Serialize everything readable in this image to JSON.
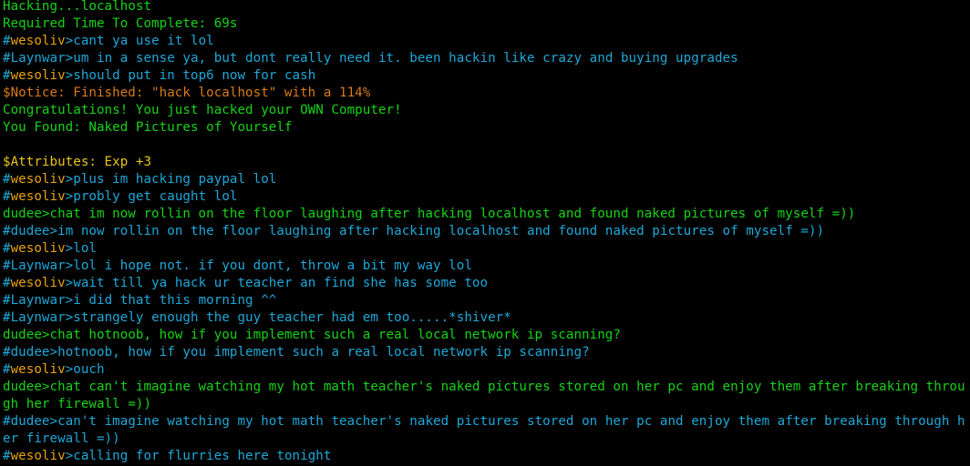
{
  "colors": {
    "system": "#17d317",
    "chat": "#1ea8d8",
    "notice": "#d97a1a",
    "attributes": "#e8c41a",
    "highlight_name": "#e8a30f",
    "background": "#000000"
  },
  "lines": [
    {
      "type": "system",
      "text": "Hacking...localhost"
    },
    {
      "type": "system",
      "text": "Required Time To Complete: 69s"
    },
    {
      "type": "chat",
      "prefix": "#",
      "user": "wesoliv",
      "highlight": true,
      "message": "cant ya use it lol"
    },
    {
      "type": "chat",
      "prefix": "#",
      "user": "Laynwar",
      "highlight": false,
      "message": "um in a sense ya, but dont really need it. been hackin like crazy and buying upgrades"
    },
    {
      "type": "chat",
      "prefix": "#",
      "user": "wesoliv",
      "highlight": true,
      "message": "should put in top6 now for cash"
    },
    {
      "type": "notice",
      "text": "$Notice: Finished: \"hack localhost\" with a 114%"
    },
    {
      "type": "system",
      "text": "Congratulations! You just hacked your OWN Computer!"
    },
    {
      "type": "system",
      "text": "You Found: Naked Pictures of Yourself"
    },
    {
      "type": "blank",
      "text": ""
    },
    {
      "type": "attributes",
      "text": "$Attributes: Exp +3"
    },
    {
      "type": "chat",
      "prefix": "#",
      "user": "wesoliv",
      "highlight": true,
      "message": "plus im hacking paypal lol"
    },
    {
      "type": "chat",
      "prefix": "#",
      "user": "wesoliv",
      "highlight": true,
      "message": "probly get caught lol"
    },
    {
      "type": "system",
      "text": "dudee>chat im now rollin on the floor laughing after hacking localhost and found naked pictures of myself =))"
    },
    {
      "type": "chat",
      "prefix": "#",
      "user": "dudee",
      "highlight": false,
      "message": "im now rollin on the floor laughing after hacking localhost and found naked pictures of myself =))"
    },
    {
      "type": "chat",
      "prefix": "#",
      "user": "wesoliv",
      "highlight": true,
      "message": "lol"
    },
    {
      "type": "chat",
      "prefix": "#",
      "user": "Laynwar",
      "highlight": false,
      "message": "lol i hope not. if you dont, throw a bit my way lol"
    },
    {
      "type": "chat",
      "prefix": "#",
      "user": "wesoliv",
      "highlight": true,
      "message": "wait till ya hack ur teacher an find she has some too"
    },
    {
      "type": "chat",
      "prefix": "#",
      "user": "Laynwar",
      "highlight": false,
      "message": "i did that this morning ^^"
    },
    {
      "type": "chat",
      "prefix": "#",
      "user": "Laynwar",
      "highlight": false,
      "message": "strangely enough the guy teacher had em too.....*shiver*"
    },
    {
      "type": "system",
      "text": "dudee>chat hotnoob, how if you implement such a real local network ip scanning?"
    },
    {
      "type": "chat",
      "prefix": "#",
      "user": "dudee",
      "highlight": false,
      "message": "hotnoob, how if you implement such a real local network ip scanning?"
    },
    {
      "type": "chat",
      "prefix": "#",
      "user": "wesoliv",
      "highlight": true,
      "message": "ouch"
    },
    {
      "type": "system",
      "text": "dudee>chat can't imagine watching my hot math teacher's naked pictures stored on her pc and enjoy them after breaking through her firewall =))"
    },
    {
      "type": "chat",
      "prefix": "#",
      "user": "dudee",
      "highlight": false,
      "message": "can't imagine watching my hot math teacher's naked pictures stored on her pc and enjoy them after breaking through her firewall =))"
    },
    {
      "type": "chat",
      "prefix": "#",
      "user": "wesoliv",
      "highlight": true,
      "message": "calling for flurries here tonight"
    }
  ]
}
